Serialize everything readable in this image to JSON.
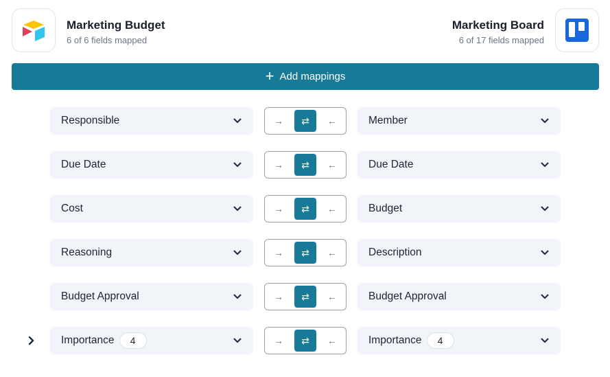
{
  "source": {
    "title": "Marketing Budget",
    "subtitle": "6 of 6 fields mapped",
    "logo": "airtable-logo"
  },
  "target": {
    "title": "Marketing Board",
    "subtitle": "6 of 17 fields mapped",
    "logo": "trello-logo"
  },
  "add_button": {
    "icon": "plus-icon",
    "label": "Add mappings"
  },
  "colors": {
    "accent": "#177b98",
    "field_bg": "#f1f4f8"
  },
  "direction_icons": {
    "left_to_right": "→",
    "two_way": "⇄",
    "right_to_left": "←"
  },
  "mappings": [
    {
      "left": "Responsible",
      "right": "Member",
      "direction": "two-way"
    },
    {
      "left": "Due Date",
      "right": "Due Date",
      "direction": "two-way"
    },
    {
      "left": "Cost",
      "right": "Budget",
      "direction": "two-way"
    },
    {
      "left": "Reasoning",
      "right": "Description",
      "direction": "two-way"
    },
    {
      "left": "Budget Approval",
      "right": "Budget Approval",
      "direction": "two-way"
    },
    {
      "left": "Importance",
      "left_badge": "4",
      "right": "Importance",
      "right_badge": "4",
      "direction": "two-way",
      "expandable": true
    }
  ]
}
